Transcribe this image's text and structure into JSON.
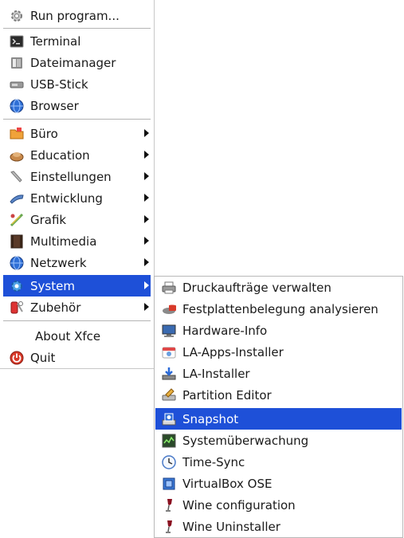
{
  "main_menu": {
    "run_program": "Run program...",
    "terminal": "Terminal",
    "file_manager": "Dateimanager",
    "usb_stick": "USB-Stick",
    "browser": "Browser",
    "categories": [
      {
        "label": "Büro",
        "icon": "office-folder-icon"
      },
      {
        "label": "Education",
        "icon": "education-icon"
      },
      {
        "label": "Einstellungen",
        "icon": "settings-wrench-icon"
      },
      {
        "label": "Entwicklung",
        "icon": "development-icon"
      },
      {
        "label": "Grafik",
        "icon": "graphics-icon"
      },
      {
        "label": "Multimedia",
        "icon": "multimedia-icon"
      },
      {
        "label": "Netzwerk",
        "icon": "network-globe-icon"
      },
      {
        "label": "System",
        "icon": "system-gear-icon"
      },
      {
        "label": "Zubehör",
        "icon": "accessories-icon"
      }
    ],
    "about": "About Xfce",
    "quit": "Quit"
  },
  "system_submenu": {
    "items": [
      {
        "label": "Druckaufträge verwalten",
        "icon": "printer-icon"
      },
      {
        "label": "Festplattenbelegung analysieren",
        "icon": "disk-usage-icon"
      },
      {
        "label": "Hardware-Info",
        "icon": "monitor-icon"
      },
      {
        "label": "LA-Apps-Installer",
        "icon": "app-installer-icon"
      },
      {
        "label": "LA-Installer",
        "icon": "installer-icon"
      },
      {
        "label": "Partition Editor",
        "icon": "partition-editor-icon"
      },
      {
        "label": "Snapshot",
        "icon": "snapshot-icon"
      },
      {
        "label": "Systemüberwachung",
        "icon": "system-monitor-icon"
      },
      {
        "label": "Time-Sync",
        "icon": "clock-icon"
      },
      {
        "label": "VirtualBox OSE",
        "icon": "virtualbox-icon"
      },
      {
        "label": "Wine configuration",
        "icon": "wine-glass-icon"
      },
      {
        "label": "Wine Uninstaller",
        "icon": "wine-glass-icon"
      }
    ]
  },
  "colors": {
    "selection": "#1e50d8",
    "selection_text": "#ffffff"
  }
}
